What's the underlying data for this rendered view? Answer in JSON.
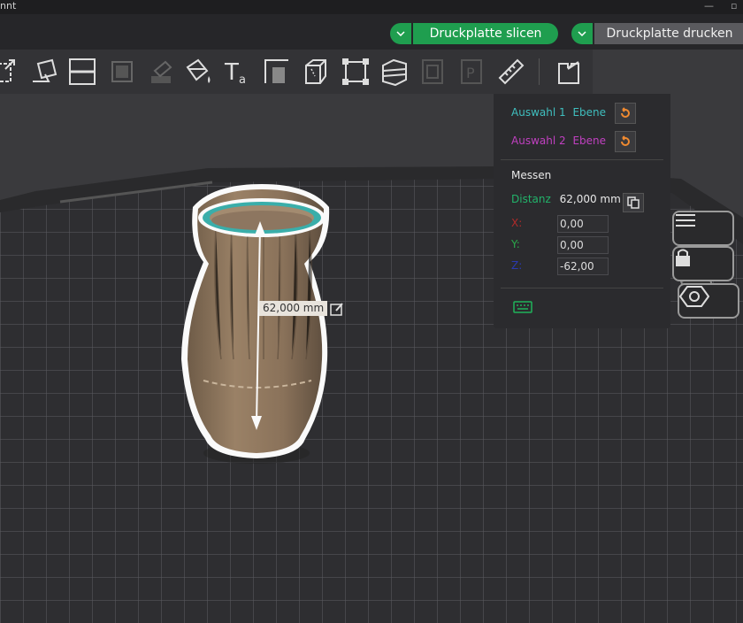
{
  "titlebar": {
    "title": "nnt"
  },
  "topbar": {
    "slice_label": "Druckplatte slicen",
    "print_label": "Druckplatte drucken"
  },
  "toolbar": {
    "tools": [
      "arrange-icon",
      "orient-icon",
      "split-icon",
      "layers-icon",
      "paint-bucket-icon",
      "supports-paint-icon",
      "color-paint-icon",
      "text-icon",
      "emboss-icon",
      "cut-icon",
      "scale-icon",
      "variable-layer-icon",
      "seam-icon",
      "brim-icon",
      "measure-icon",
      "assembly-icon"
    ]
  },
  "measure": {
    "label": "62,000 mm"
  },
  "panel": {
    "selection1_label": "Auswahl 1",
    "selection1_value": "Ebene",
    "selection2_label": "Auswahl 2",
    "selection2_value": "Ebene",
    "section_title": "Messen",
    "distance_label": "Distanz",
    "distance_value": "62,000 mm",
    "x_label": "X:",
    "x_value": "0,00",
    "y_label": "Y:",
    "y_value": "0,00",
    "z_label": "Z:",
    "z_value": "-62,00"
  },
  "colors": {
    "accent_green": "#1f9e4f",
    "selection1": "#3fbfbf",
    "selection2": "#c040c0",
    "distance": "#22b36a"
  }
}
